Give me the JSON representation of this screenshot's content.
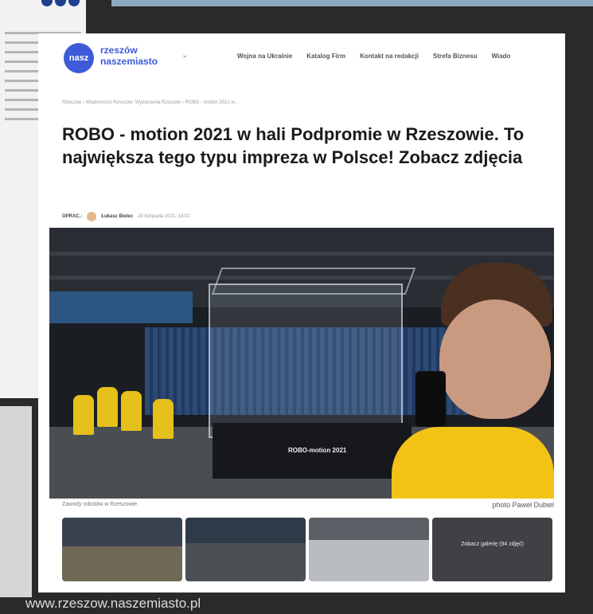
{
  "site": {
    "logo_badge": "nasz",
    "logo_line1": "rzeszów",
    "logo_line2": "naszemiasto",
    "nav_items": [
      "Wojna na Ukrainie",
      "Katalog Firm",
      "Kontakt na redakcji",
      "Strefa Biznesu",
      "Wiado"
    ]
  },
  "article": {
    "breadcrumb": "Rzeszów › Wiadomości Rzeszów: Wydarzenia Rzeszów › ROBO - motion 2021 w...",
    "title": "ROBO - motion 2021 w hali Podpromie w Rzeszowie. To największa tego typu impreza w Polsce! Zobacz zdjęcia",
    "meta_label": "OPRAC.:",
    "author": "Łukasz Bielec",
    "date": "28 listopada 2021, 18:02",
    "photo_label": "ROBO-motion 2021",
    "caption": "Zawody robotów w Rzeszowie.",
    "photo_credit": "photo Paweł Dubiel",
    "gallery_more": "Zobacz galerię (94 zdjęć)"
  },
  "source_url": "www.rzeszow.naszemiasto.pl",
  "colors": {
    "brand": "#3d5bd8",
    "frame": "#2b2a2a",
    "shirt": "#f2c315"
  }
}
